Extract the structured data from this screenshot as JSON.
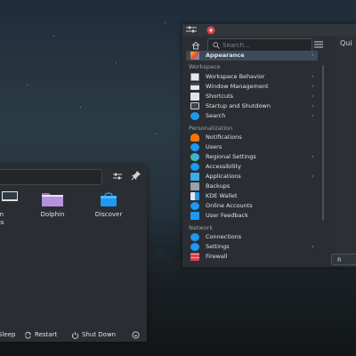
{
  "launcher": {
    "search_value": "",
    "apps": [
      {
        "label_top": "",
        "label": "em\ntings",
        "l1": "em",
        "l2": "ings"
      },
      {
        "label": "Dolphin"
      },
      {
        "label": "Discover"
      }
    ],
    "power": {
      "sleep": "Sleep",
      "restart": "Restart",
      "shutdown": "Shut Down"
    }
  },
  "settings": {
    "search_placeholder": "Search...",
    "content_title": "Qui",
    "reset_button": "R",
    "items": {
      "appearance": "Appearance",
      "workspace_header": "Workspace",
      "workspace_behavior": "Workspace Behavior",
      "window_management": "Window Management",
      "shortcuts": "Shortcuts",
      "startup_shutdown": "Startup and Shutdown",
      "search": "Search",
      "personalization_header": "Personalization",
      "notifications": "Notifications",
      "users": "Users",
      "regional": "Regional Settings",
      "accessibility": "Accessibility",
      "applications": "Applications",
      "backups": "Backups",
      "kde_wallet": "KDE Wallet",
      "online_accounts": "Online Accounts",
      "user_feedback": "User Feedback",
      "network_header": "Network",
      "connections": "Connections",
      "settings": "Settings",
      "firewall": "Firewall"
    },
    "chevron": "›"
  },
  "colors": {
    "panel": "#2a2e32",
    "selection": "#3d4a5a",
    "accent": "#3daee9"
  }
}
